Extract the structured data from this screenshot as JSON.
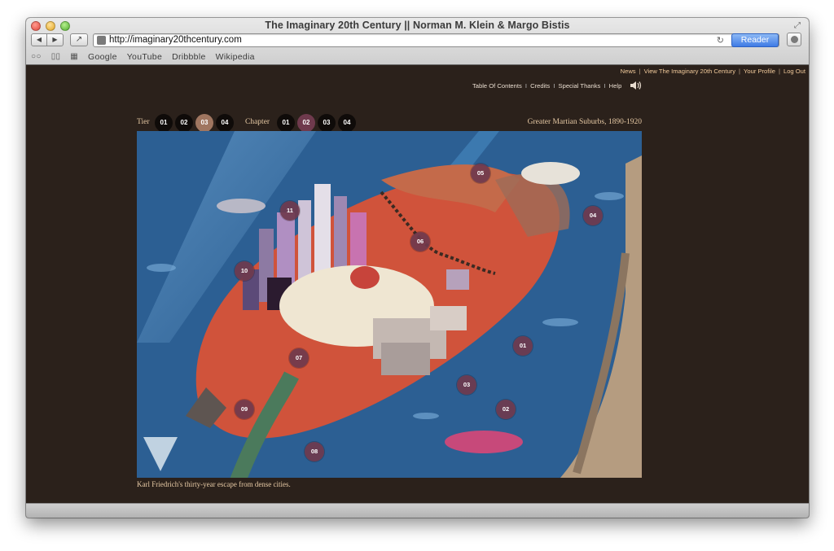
{
  "window": {
    "title": "The Imaginary 20th Century || Norman M. Klein & Margo Bistis"
  },
  "toolbar": {
    "url": "http://imaginary20thcentury.com",
    "reader_label": "Reader"
  },
  "bookmarks": [
    "Google",
    "YouTube",
    "Dribbble",
    "Wikipedia"
  ],
  "topnav": {
    "items": [
      "News",
      "View The Imaginary 20th Century",
      "Your Profile",
      "Log Out"
    ]
  },
  "subnav": {
    "items": [
      "Table Of Contents",
      "Credits",
      "Special Thanks",
      "Help"
    ]
  },
  "tiers": {
    "label": "Tier",
    "items": [
      {
        "label": "01",
        "state": "normal"
      },
      {
        "label": "02",
        "state": "normal"
      },
      {
        "label": "03",
        "state": "active"
      },
      {
        "label": "04",
        "state": "normal"
      }
    ]
  },
  "chapters": {
    "label": "Chapter",
    "items": [
      {
        "label": "01",
        "state": "normal"
      },
      {
        "label": "02",
        "state": "current"
      },
      {
        "label": "03",
        "state": "normal"
      },
      {
        "label": "04",
        "state": "normal"
      }
    ]
  },
  "region_title": "Greater Martian Suburbs, 1890-1920",
  "map_markers": [
    "01",
    "02",
    "03",
    "04",
    "05",
    "06",
    "07",
    "08",
    "09",
    "10",
    "11"
  ],
  "caption": "Karl Friedrich's thirty-year escape from dense cities.",
  "colors": {
    "page_bg": "#2b211b",
    "accent_text": "#f0c99a",
    "map_water": "#2c5f93",
    "land": "#d0533b",
    "marker": "#6f3a4d",
    "tier_active": "#a07660"
  }
}
